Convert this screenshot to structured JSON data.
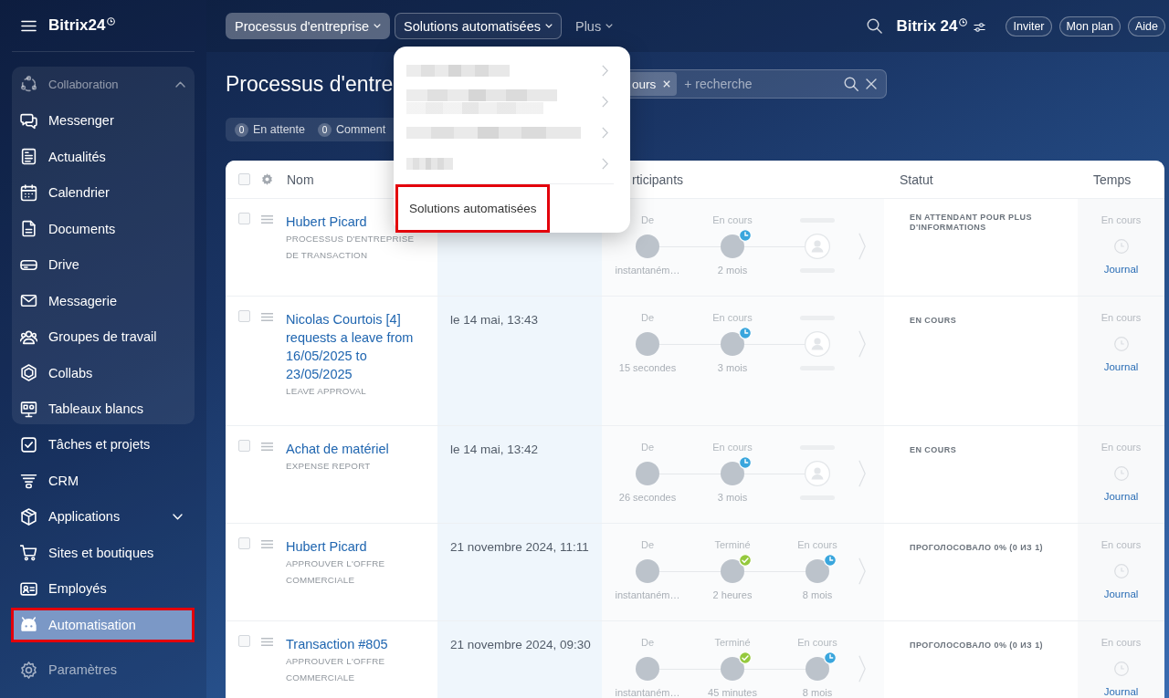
{
  "sidebar": {
    "logo": "Bitrix24",
    "group": {
      "label": "Collaboration",
      "expanded": true,
      "items": [
        {
          "label": "Messenger",
          "selected": false,
          "highlighted": false
        },
        {
          "label": "Actualités",
          "selected": false,
          "highlighted": false
        },
        {
          "label": "Calendrier",
          "selected": false,
          "highlighted": false
        },
        {
          "label": "Documents",
          "selected": false,
          "highlighted": false
        },
        {
          "label": "Drive",
          "selected": false,
          "highlighted": false
        },
        {
          "label": "Messagerie",
          "selected": false,
          "highlighted": false
        },
        {
          "label": "Groupes de travail",
          "selected": false,
          "highlighted": false
        },
        {
          "label": "Collabs",
          "selected": false,
          "highlighted": false
        },
        {
          "label": "Tableaux blancs",
          "selected": false,
          "highlighted": false
        }
      ]
    },
    "items": [
      {
        "label": "Tâches et projets",
        "kind": "link",
        "selected": false,
        "highlighted": false
      },
      {
        "label": "CRM",
        "kind": "link",
        "selected": false,
        "highlighted": false
      },
      {
        "label": "Applications",
        "kind": "submenu",
        "expanded": false,
        "selected": false,
        "highlighted": false
      },
      {
        "label": "Sites et boutiques",
        "kind": "link",
        "selected": false,
        "highlighted": false
      },
      {
        "label": "Employés",
        "kind": "link",
        "selected": false,
        "highlighted": false
      },
      {
        "label": "Automatisation",
        "kind": "link",
        "selected": true,
        "highlighted": true
      }
    ],
    "footer_item": {
      "label": "Paramètres"
    }
  },
  "topbar": {
    "menu": [
      {
        "label": "Processus d'entreprise",
        "selected": true,
        "expanded": false
      },
      {
        "label": "Solutions automatisées",
        "selected": false,
        "expanded": true
      },
      {
        "label": "Plus",
        "selected": false,
        "expanded": false
      }
    ],
    "logo": "Bitrix 24",
    "buttons": [
      "Inviter",
      "Mon plan",
      "Aide"
    ]
  },
  "dropdown": {
    "items": [
      {
        "kind": "redacted",
        "highlighted": false
      },
      {
        "kind": "redacted",
        "highlighted": false
      },
      {
        "kind": "redacted",
        "highlighted": false
      },
      {
        "kind": "redacted",
        "highlighted": false
      },
      {
        "kind": "action",
        "label": "Solutions automatisées",
        "highlighted": true
      }
    ]
  },
  "page": {
    "title": "Processus d'entre",
    "filter": {
      "tag": "ours",
      "placeholder": "+ recherche"
    },
    "counters": [
      {
        "count": "0",
        "label": "En attente"
      },
      {
        "count": "0",
        "label": "Comment"
      }
    ]
  },
  "table": {
    "select_all": {
      "checked": false
    },
    "columns": [
      "Nom",
      "rticipants",
      "Statut",
      "Temps"
    ],
    "rows": [
      {
        "checked": false,
        "title": "Hubert Picard",
        "subtitle": "PROCESSUS D'ENTREPRISE DE TRANSACTION",
        "steps": [
          {
            "kind": "start",
            "label": "De",
            "time": "instantaném…"
          },
          {
            "kind": "running",
            "label": "En cours",
            "time": "2 mois"
          },
          {
            "kind": "empty"
          }
        ],
        "status": "EN ATTENDANT POUR PLUS D'INFORMATIONS",
        "time_label": "En cours",
        "log_link": "Journal"
      },
      {
        "checked": false,
        "title": "Nicolas Courtois [4] requests a leave from 16/05/2025 to 23/05/2025",
        "subtitle": "LEAVE APPROVAL",
        "date": "le 14 mai, 13:43",
        "steps": [
          {
            "kind": "start",
            "label": "De",
            "time": "15 secondes"
          },
          {
            "kind": "running",
            "label": "En cours",
            "time": "3 mois"
          },
          {
            "kind": "empty"
          }
        ],
        "status": "EN COURS",
        "time_label": "En cours",
        "log_link": "Journal"
      },
      {
        "checked": false,
        "title": "Achat de matériel",
        "subtitle": "EXPENSE REPORT",
        "date": "le 14 mai, 13:42",
        "steps": [
          {
            "kind": "start",
            "label": "De",
            "time": "26 secondes"
          },
          {
            "kind": "running",
            "label": "En cours",
            "time": "3 mois"
          },
          {
            "kind": "empty"
          }
        ],
        "status": "EN COURS",
        "time_label": "En cours",
        "log_link": "Journal"
      },
      {
        "checked": false,
        "title": "Hubert Picard",
        "subtitle": "APPROUVER L'OFFRE COMMERCIALE",
        "date": "21 novembre 2024, 11:11",
        "steps": [
          {
            "kind": "start",
            "label": "De",
            "time": "instantaném…"
          },
          {
            "kind": "done",
            "label": "Terminé",
            "time": "2 heures"
          },
          {
            "kind": "running",
            "label": "En cours",
            "time": "8 mois"
          }
        ],
        "status": "ПРОГОЛОСОВАЛО 0% (0 ИЗ 1)",
        "time_label": "En cours",
        "log_link": "Journal"
      },
      {
        "checked": false,
        "title": "Transaction #805",
        "subtitle": "APPROUVER L'OFFRE COMMERCIALE",
        "date": "21 novembre 2024, 09:30",
        "steps": [
          {
            "kind": "start",
            "label": "De",
            "time": "instantaném…"
          },
          {
            "kind": "done",
            "label": "Terminé",
            "time": "45 minutes"
          },
          {
            "kind": "running",
            "label": "En cours",
            "time": "8 mois"
          }
        ],
        "status": "ПРОГОЛОСОВАЛО 0% (0 ИЗ 1)",
        "time_label": "En cours",
        "log_link": "Journal"
      }
    ]
  }
}
